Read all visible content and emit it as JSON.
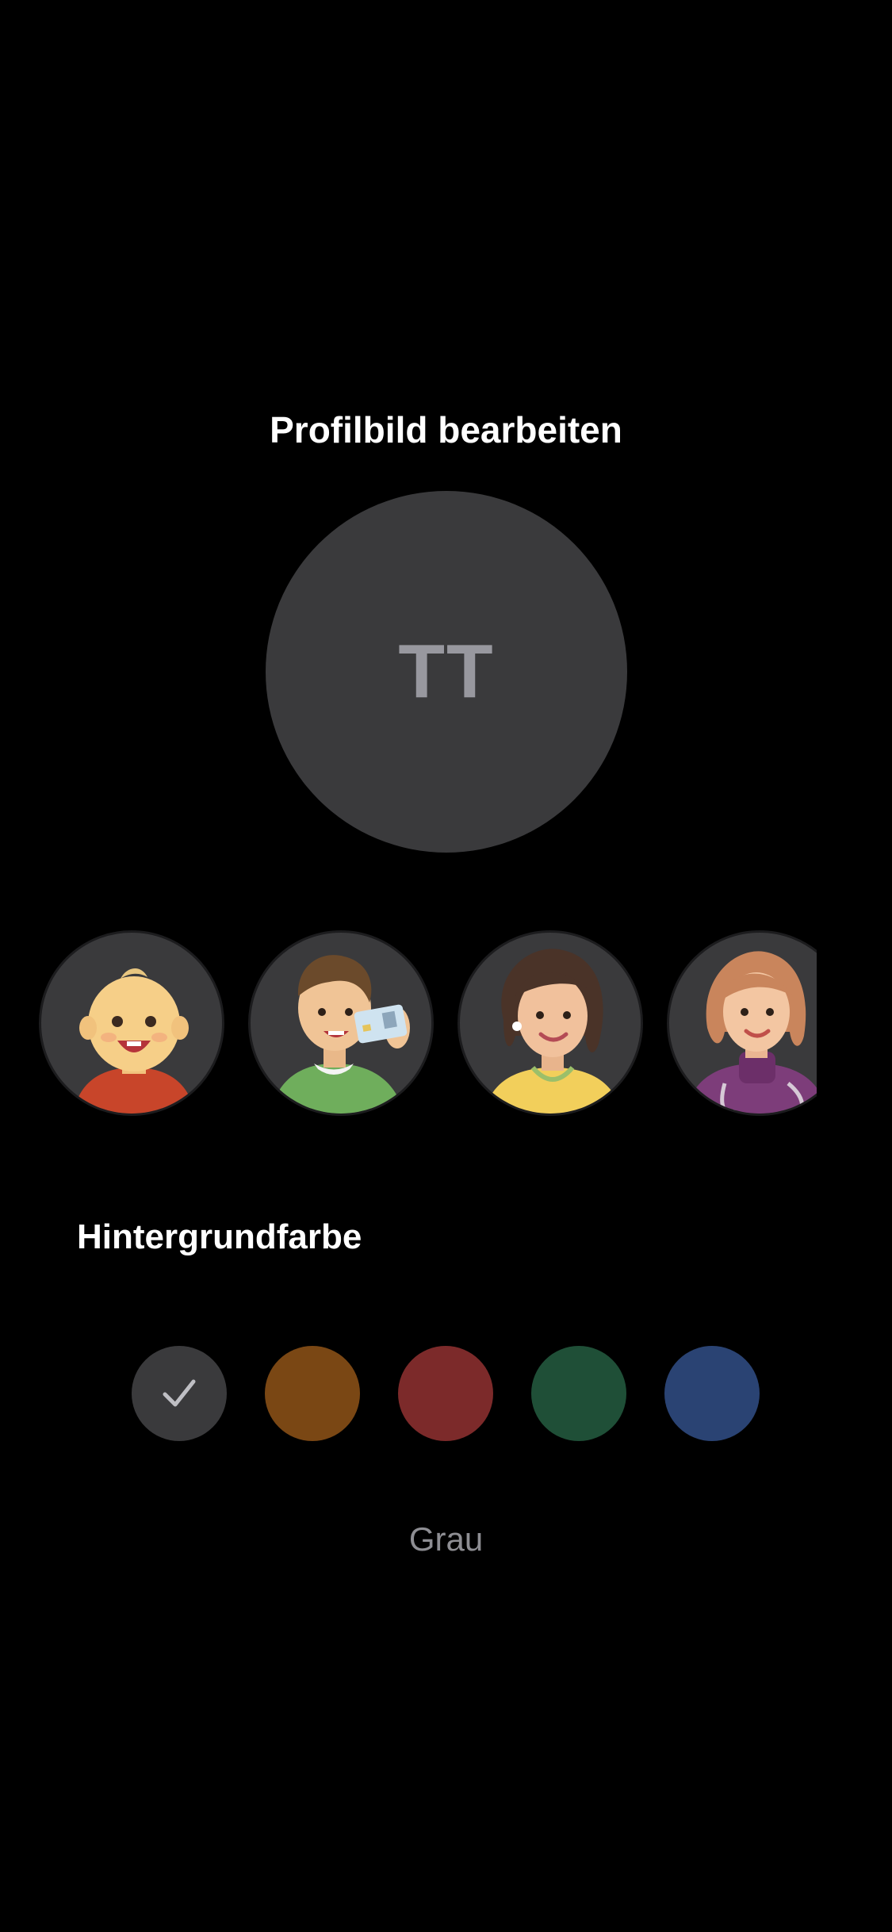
{
  "header": {
    "title": "Profilbild bearbeiten"
  },
  "profile": {
    "initials": "TT",
    "background_color": "#3a3a3c",
    "initials_color": "#98989f"
  },
  "avatar_presets": [
    {
      "name": "baby-avatar"
    },
    {
      "name": "young-man-id-card-avatar"
    },
    {
      "name": "woman-earring-avatar"
    },
    {
      "name": "doctor-stethoscope-avatar"
    }
  ],
  "background_section": {
    "title": "Hintergrundfarbe",
    "swatches": [
      {
        "name": "Grau",
        "color": "#3a3a3c",
        "selected": true
      },
      {
        "name": "orange",
        "color": "#7a4714",
        "selected": false
      },
      {
        "name": "red",
        "color": "#7c2a2a",
        "selected": false
      },
      {
        "name": "green",
        "color": "#1f4f37",
        "selected": false
      },
      {
        "name": "blue",
        "color": "#2a4373",
        "selected": false
      }
    ],
    "selected_label": "Grau"
  }
}
